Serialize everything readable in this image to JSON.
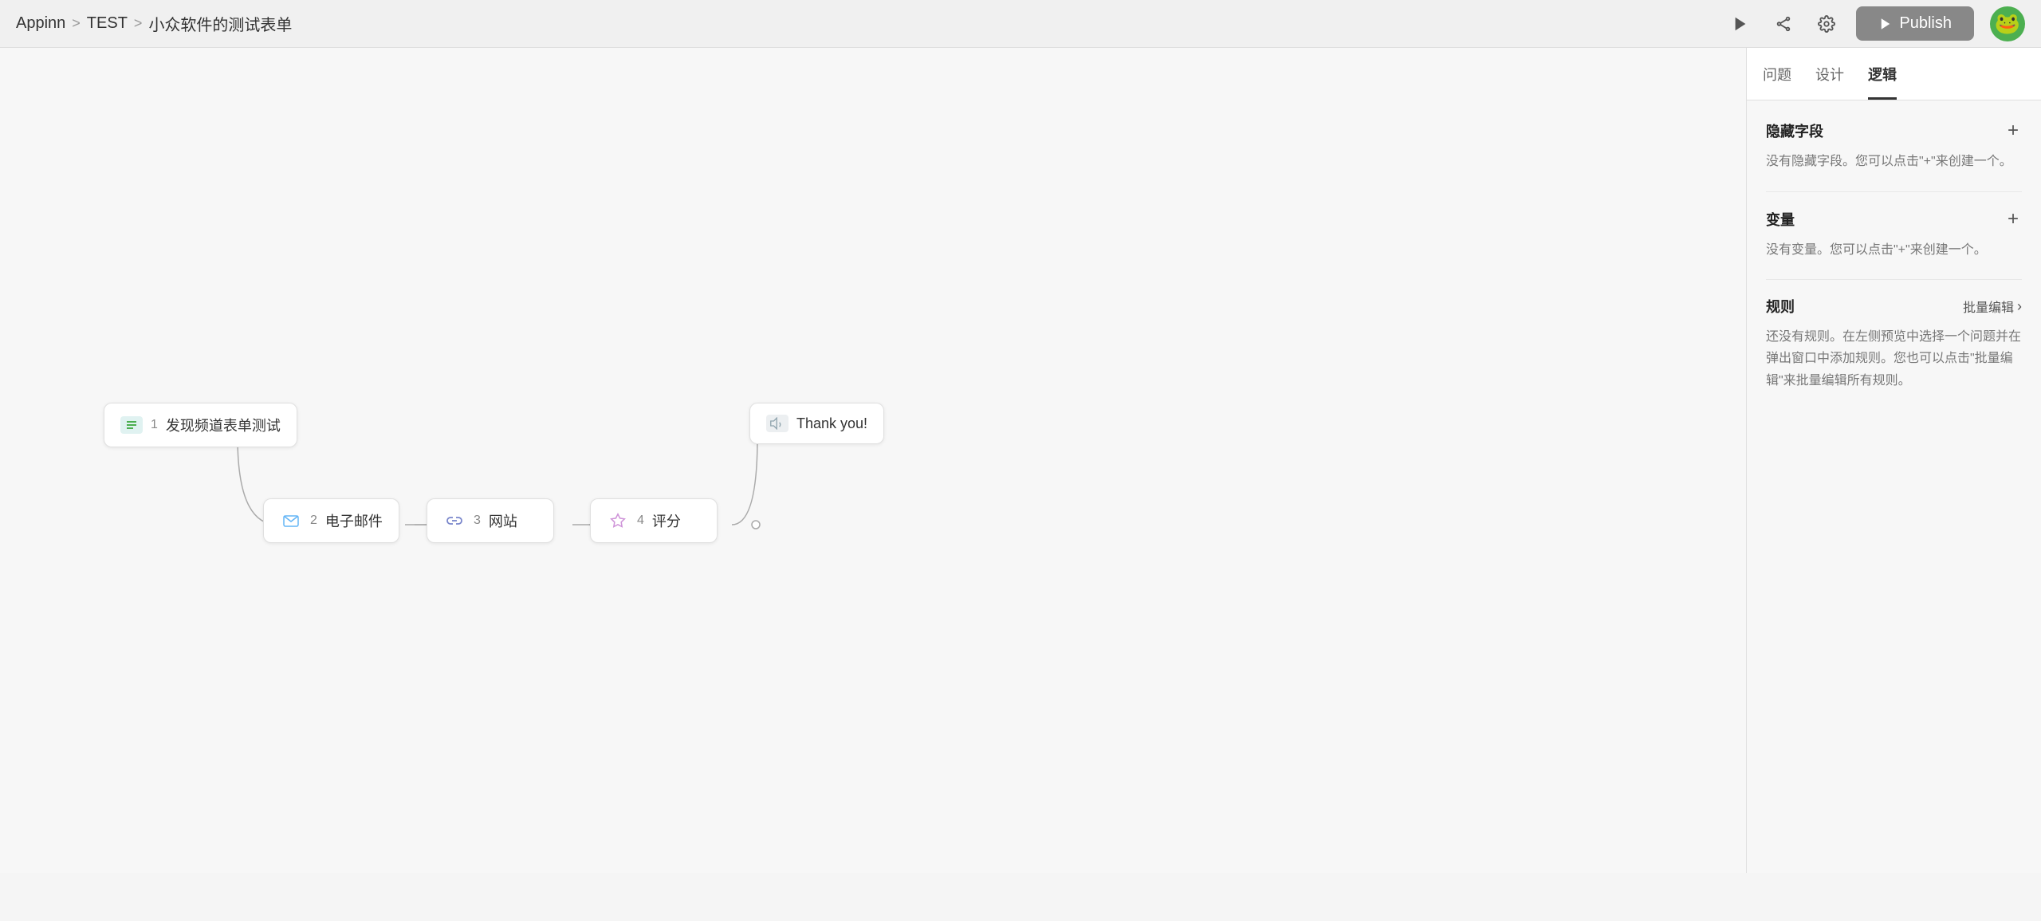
{
  "header": {
    "breadcrumb": {
      "appinn": "Appinn",
      "sep1": ">",
      "test": "TEST",
      "sep2": ">",
      "form_name": "小众软件的测试表单"
    },
    "publish_label": "Publish"
  },
  "tabs": {
    "items": [
      {
        "id": "questions",
        "label": "问题"
      },
      {
        "id": "design",
        "label": "设计"
      },
      {
        "id": "logic",
        "label": "逻辑",
        "active": true
      }
    ]
  },
  "panel": {
    "hidden_fields": {
      "title": "隐藏字段",
      "desc": "没有隐藏字段。您可以点击\"+\"来创建一个。"
    },
    "variables": {
      "title": "变量",
      "desc": "没有变量。您可以点击\"+\"来创建一个。"
    },
    "rules": {
      "title": "规则",
      "batch_edit": "批量编辑",
      "desc": "还没有规则。在左侧预览中选择一个问题并在弹出窗口中添加规则。您也可以点击\"批量编辑\"来批量编辑所有规则。"
    }
  },
  "flow": {
    "nodes": [
      {
        "id": "node1",
        "num": "1",
        "label": "发现频道表单测试",
        "icon": "list"
      },
      {
        "id": "node2",
        "num": "2",
        "label": "电子邮件",
        "icon": "email"
      },
      {
        "id": "node3",
        "num": "3",
        "label": "网站",
        "icon": "link"
      },
      {
        "id": "node4",
        "num": "4",
        "label": "评分",
        "icon": "star"
      },
      {
        "id": "nodety",
        "label": "Thank you!",
        "icon": "speaker"
      }
    ]
  },
  "colors": {
    "accent": "#333333",
    "publish_bg": "#888888",
    "active_tab_border": "#333333"
  }
}
